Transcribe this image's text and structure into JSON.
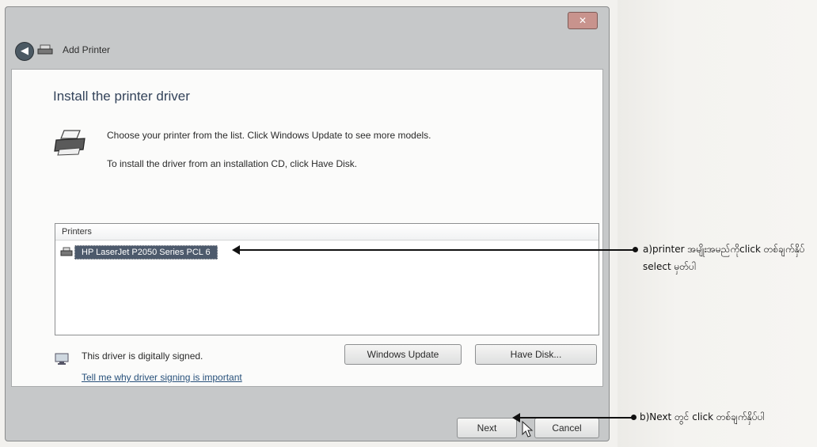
{
  "window": {
    "title": "Add Printer",
    "close_label": "✕",
    "back_label": "◀"
  },
  "page": {
    "heading": "Install the printer driver",
    "line1": "Choose your printer from the list. Click Windows Update to see more models.",
    "line2": "To install the driver from an installation CD, click Have Disk."
  },
  "printers": {
    "header": "Printers",
    "items": [
      {
        "label": "HP LaserJet P2050 Series PCL 6",
        "selected": true
      }
    ]
  },
  "driver": {
    "signed_text": "This driver is digitally signed.",
    "why_link": "Tell me why driver signing is important"
  },
  "buttons": {
    "windows_update": "Windows Update",
    "have_disk": "Have Disk...",
    "next": "Next",
    "cancel": "Cancel"
  },
  "annotations": {
    "a": "a)printer အမျိုးအမည်ကိုclick တစ်ချက်နှိပ် select မှတ်ပါ",
    "b": "b)Next တွင် click တစ်ချက်နှိပ်ပါ"
  },
  "colors": {
    "selection": "#4d5a6c",
    "link": "#27507a",
    "close_button": "#c8938d"
  }
}
